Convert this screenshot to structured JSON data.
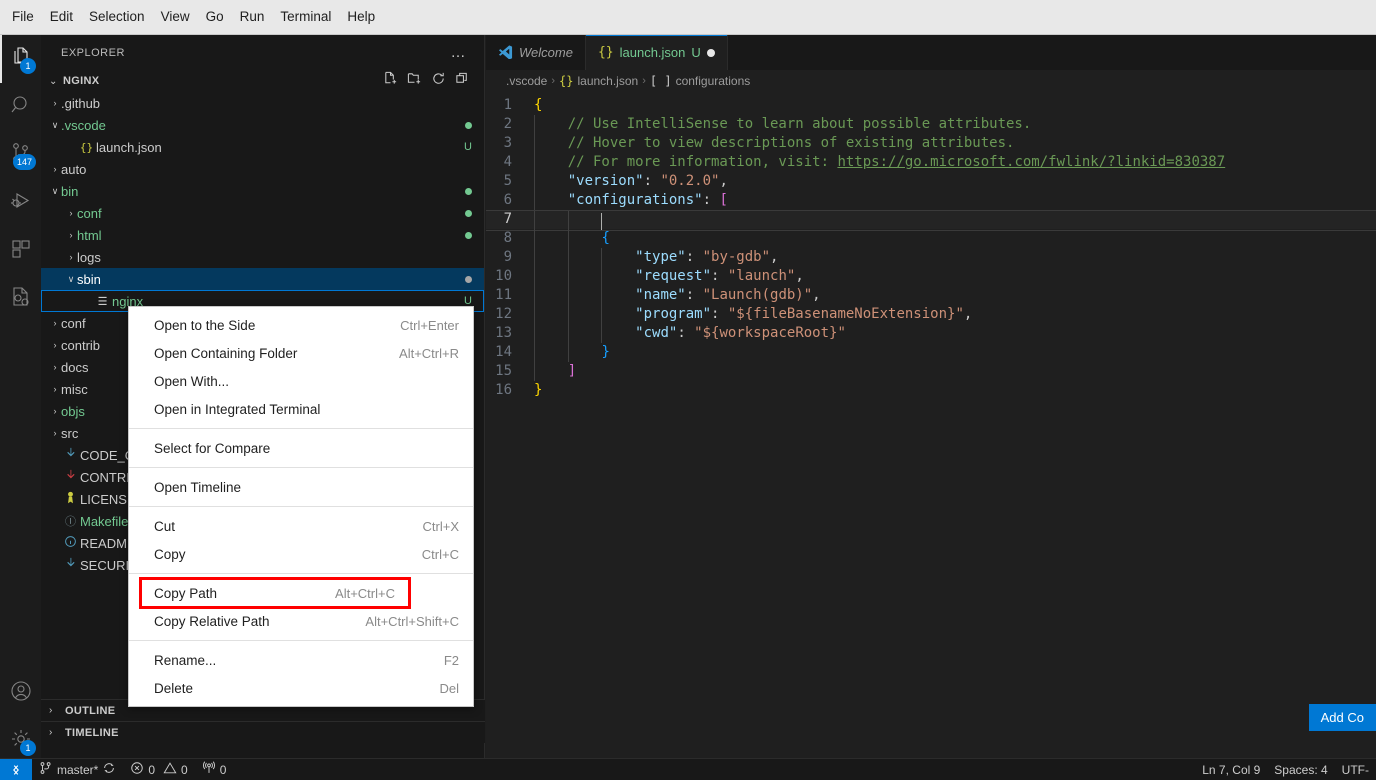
{
  "menubar": {
    "items": [
      {
        "label": "File"
      },
      {
        "label": "Edit"
      },
      {
        "label": "Selection"
      },
      {
        "label": "View"
      },
      {
        "label": "Go"
      },
      {
        "label": "Run"
      },
      {
        "label": "Terminal"
      },
      {
        "label": "Help"
      }
    ]
  },
  "activitybar": {
    "items": [
      {
        "name": "explorer",
        "icon": "files-icon",
        "badge": "1",
        "active": true
      },
      {
        "name": "search",
        "icon": "search-icon",
        "badge": "",
        "active": false
      },
      {
        "name": "source-control",
        "icon": "source-control-icon",
        "badge": "147",
        "active": false
      },
      {
        "name": "run-debug",
        "icon": "run-and-debug-icon",
        "badge": "",
        "active": false
      },
      {
        "name": "extensions",
        "icon": "extensions-icon",
        "badge": "",
        "active": false
      },
      {
        "name": "cpp-config",
        "icon": "cpp-gear-icon",
        "badge": "",
        "active": false
      }
    ],
    "bottom": [
      {
        "name": "accounts",
        "icon": "account-icon",
        "badge": ""
      },
      {
        "name": "manage",
        "icon": "gear-icon",
        "badge": "1"
      }
    ]
  },
  "sidebar": {
    "title": "EXPLORER",
    "more_label": "…",
    "tree_title": "NGINX",
    "tree_actions": [
      "new-file-icon",
      "new-folder-icon",
      "refresh-icon",
      "collapse-all-icon"
    ],
    "items": [
      {
        "label": ".github",
        "icon": "folder-icon",
        "twisty": "›",
        "indent": 0,
        "color": "#cccccc",
        "dec": "",
        "dot": ""
      },
      {
        "label": ".vscode",
        "icon": "folder-icon",
        "twisty": "∨",
        "indent": 0,
        "color": "#73c991",
        "dec": "",
        "dot": "#73c991"
      },
      {
        "label": "launch.json",
        "icon": "json-icon",
        "twisty": "",
        "indent": 1,
        "color": "#cccccc",
        "dec": "U",
        "dot": ""
      },
      {
        "label": "auto",
        "icon": "folder-icon",
        "twisty": "›",
        "indent": 0,
        "color": "#cccccc",
        "dec": "",
        "dot": ""
      },
      {
        "label": "bin",
        "icon": "folder-icon",
        "twisty": "∨",
        "indent": 0,
        "color": "#73c991",
        "dec": "",
        "dot": "#73c991"
      },
      {
        "label": "conf",
        "icon": "folder-icon",
        "twisty": "›",
        "indent": 1,
        "color": "#73c991",
        "dec": "",
        "dot": "#73c991"
      },
      {
        "label": "html",
        "icon": "folder-icon",
        "twisty": "›",
        "indent": 1,
        "color": "#73c991",
        "dec": "",
        "dot": "#73c991"
      },
      {
        "label": "logs",
        "icon": "folder-icon",
        "twisty": "›",
        "indent": 1,
        "color": "#cccccc",
        "dec": "",
        "dot": ""
      },
      {
        "label": "sbin",
        "icon": "folder-icon",
        "twisty": "∨",
        "indent": 1,
        "color": "#ffffff",
        "dec": "",
        "dot": "#a6a6a6",
        "selected": true
      },
      {
        "label": "nginx",
        "icon": "binary-icon",
        "twisty": "",
        "indent": 2,
        "color": "#73c991",
        "dec": "U",
        "dot": "",
        "focused": true
      },
      {
        "label": "conf",
        "icon": "folder-icon",
        "twisty": "›",
        "indent": 0,
        "color": "#cccccc",
        "dec": "",
        "dot": ""
      },
      {
        "label": "contrib",
        "icon": "folder-icon",
        "twisty": "›",
        "indent": 0,
        "color": "#cccccc",
        "dec": "",
        "dot": ""
      },
      {
        "label": "docs",
        "icon": "folder-icon",
        "twisty": "›",
        "indent": 0,
        "color": "#cccccc",
        "dec": "",
        "dot": ""
      },
      {
        "label": "misc",
        "icon": "folder-icon",
        "twisty": "›",
        "indent": 0,
        "color": "#cccccc",
        "dec": "",
        "dot": ""
      },
      {
        "label": "objs",
        "icon": "folder-icon",
        "twisty": "›",
        "indent": 0,
        "color": "#73c991",
        "dec": "",
        "dot": ""
      },
      {
        "label": "src",
        "icon": "folder-icon",
        "twisty": "›",
        "indent": 0,
        "color": "#cccccc",
        "dec": "",
        "dot": ""
      },
      {
        "label": "CODE_OF_CONDUCT.md",
        "icon": "markdown-icon",
        "twisty": "",
        "indent": 0,
        "color": "#cccccc",
        "dec": "",
        "dot": "",
        "iconcolor": "#519aba"
      },
      {
        "label": "CONTRIBUTING.md",
        "icon": "markdown-icon",
        "twisty": "",
        "indent": 0,
        "color": "#cccccc",
        "dec": "",
        "dot": "",
        "iconcolor": "#cc3e44"
      },
      {
        "label": "LICENSE",
        "icon": "license-icon",
        "twisty": "",
        "indent": 0,
        "color": "#cccccc",
        "dec": "",
        "dot": "",
        "iconcolor": "#cbcb41"
      },
      {
        "label": "Makefile",
        "icon": "makefile-icon",
        "twisty": "",
        "indent": 0,
        "color": "#73c991",
        "dec": "",
        "dot": "",
        "iconcolor": "#6d8086"
      },
      {
        "label": "README.md",
        "icon": "info-icon",
        "twisty": "",
        "indent": 0,
        "color": "#cccccc",
        "dec": "",
        "dot": "",
        "iconcolor": "#519aba"
      },
      {
        "label": "SECURITY.md",
        "icon": "markdown-icon",
        "twisty": "",
        "indent": 0,
        "color": "#cccccc",
        "dec": "",
        "dot": "",
        "iconcolor": "#519aba"
      }
    ],
    "panels": [
      {
        "label": "OUTLINE",
        "chev": "›"
      },
      {
        "label": "TIMELINE",
        "chev": "›"
      }
    ]
  },
  "editor": {
    "tabs": [
      {
        "label": "Welcome",
        "icon": "vscode-logo-icon",
        "dirty": false,
        "badge": "",
        "active": false
      },
      {
        "label": "launch.json",
        "icon": "json-icon",
        "dirty": true,
        "badge": "U",
        "active": true
      }
    ],
    "breadcrumb": [
      {
        "label": ".vscode",
        "icon": ""
      },
      {
        "label": "launch.json",
        "icon": "{}"
      },
      {
        "label": "configurations",
        "icon": "[ ]"
      }
    ],
    "add_config_label": "Add Co",
    "cursor_line": 7,
    "lines": [
      {
        "n": 1,
        "tokens": [
          {
            "t": "{",
            "c": "br0"
          }
        ]
      },
      {
        "n": 2,
        "tokens": [
          {
            "t": "    // Use IntelliSense to learn about possible attributes.",
            "c": "cmt"
          }
        ]
      },
      {
        "n": 3,
        "tokens": [
          {
            "t": "    // Hover to view descriptions of existing attributes.",
            "c": "cmt"
          }
        ]
      },
      {
        "n": 4,
        "tokens": [
          {
            "t": "    // For more information, visit: ",
            "c": "cmt"
          },
          {
            "t": "https://go.microsoft.com/fwlink/?linkid=830387",
            "c": "lnk"
          }
        ]
      },
      {
        "n": 5,
        "tokens": [
          {
            "t": "    ",
            "c": ""
          },
          {
            "t": "\"version\"",
            "c": "key"
          },
          {
            "t": ": ",
            "c": ""
          },
          {
            "t": "\"0.2.0\"",
            "c": "str"
          },
          {
            "t": ",",
            "c": ""
          }
        ]
      },
      {
        "n": 6,
        "tokens": [
          {
            "t": "    ",
            "c": ""
          },
          {
            "t": "\"configurations\"",
            "c": "key"
          },
          {
            "t": ": ",
            "c": ""
          },
          {
            "t": "[",
            "c": "br1"
          }
        ]
      },
      {
        "n": 7,
        "tokens": [
          {
            "t": "        ",
            "c": ""
          }
        ],
        "current": true
      },
      {
        "n": 8,
        "tokens": [
          {
            "t": "        ",
            "c": ""
          },
          {
            "t": "{",
            "c": "br2"
          }
        ]
      },
      {
        "n": 9,
        "tokens": [
          {
            "t": "            ",
            "c": ""
          },
          {
            "t": "\"type\"",
            "c": "key"
          },
          {
            "t": ": ",
            "c": ""
          },
          {
            "t": "\"by-gdb\"",
            "c": "str"
          },
          {
            "t": ",",
            "c": ""
          }
        ]
      },
      {
        "n": 10,
        "tokens": [
          {
            "t": "            ",
            "c": ""
          },
          {
            "t": "\"request\"",
            "c": "key"
          },
          {
            "t": ": ",
            "c": ""
          },
          {
            "t": "\"launch\"",
            "c": "str"
          },
          {
            "t": ",",
            "c": ""
          }
        ]
      },
      {
        "n": 11,
        "tokens": [
          {
            "t": "            ",
            "c": ""
          },
          {
            "t": "\"name\"",
            "c": "key"
          },
          {
            "t": ": ",
            "c": ""
          },
          {
            "t": "\"Launch(gdb)\"",
            "c": "str"
          },
          {
            "t": ",",
            "c": ""
          }
        ]
      },
      {
        "n": 12,
        "tokens": [
          {
            "t": "            ",
            "c": ""
          },
          {
            "t": "\"program\"",
            "c": "key"
          },
          {
            "t": ": ",
            "c": ""
          },
          {
            "t": "\"${fileBasenameNoExtension}\"",
            "c": "str"
          },
          {
            "t": ",",
            "c": ""
          }
        ]
      },
      {
        "n": 13,
        "tokens": [
          {
            "t": "            ",
            "c": ""
          },
          {
            "t": "\"cwd\"",
            "c": "key"
          },
          {
            "t": ": ",
            "c": ""
          },
          {
            "t": "\"${workspaceRoot}\"",
            "c": "str"
          }
        ]
      },
      {
        "n": 14,
        "tokens": [
          {
            "t": "        ",
            "c": ""
          },
          {
            "t": "}",
            "c": "br2"
          }
        ]
      },
      {
        "n": 15,
        "tokens": [
          {
            "t": "    ",
            "c": ""
          },
          {
            "t": "]",
            "c": "br1"
          }
        ]
      },
      {
        "n": 16,
        "tokens": [
          {
            "t": "}",
            "c": "br0"
          }
        ]
      }
    ]
  },
  "context_menu": {
    "items": [
      {
        "label": "Open to the Side",
        "shortcut": "Ctrl+Enter",
        "sep_after": false
      },
      {
        "label": "Open Containing Folder",
        "shortcut": "Alt+Ctrl+R",
        "sep_after": false
      },
      {
        "label": "Open With...",
        "shortcut": "",
        "sep_after": false
      },
      {
        "label": "Open in Integrated Terminal",
        "shortcut": "",
        "sep_after": true
      },
      {
        "label": "Select for Compare",
        "shortcut": "",
        "sep_after": true
      },
      {
        "label": "Open Timeline",
        "shortcut": "",
        "sep_after": true
      },
      {
        "label": "Cut",
        "shortcut": "Ctrl+X",
        "sep_after": false
      },
      {
        "label": "Copy",
        "shortcut": "Ctrl+C",
        "sep_after": true
      },
      {
        "label": "Copy Path",
        "shortcut": "Alt+Ctrl+C",
        "sep_after": false,
        "highlighted": true
      },
      {
        "label": "Copy Relative Path",
        "shortcut": "Alt+Ctrl+Shift+C",
        "sep_after": true
      },
      {
        "label": "Rename...",
        "shortcut": "F2",
        "sep_after": false
      },
      {
        "label": "Delete",
        "shortcut": "Del",
        "sep_after": false
      }
    ],
    "highlight_color": "#ff0000"
  },
  "statusbar": {
    "remote_icon": "remote-window-icon",
    "left": [
      {
        "label": "master*",
        "icon": "git-branch-icon"
      },
      {
        "label": "",
        "icon": "sync-icon"
      },
      {
        "label": "0",
        "icon": "error-icon",
        "label2": "0",
        "icon2": "warning-icon"
      },
      {
        "label": "0",
        "icon": "radio-tower-icon"
      }
    ],
    "right": [
      {
        "label": "Ln 7, Col 9"
      },
      {
        "label": "Spaces: 4"
      },
      {
        "label": "UTF-"
      }
    ]
  },
  "colors": {
    "accent": "#0078d4",
    "selection": "#04395e",
    "git_modified": "#73c991",
    "highlight_red": "#ff0000"
  }
}
